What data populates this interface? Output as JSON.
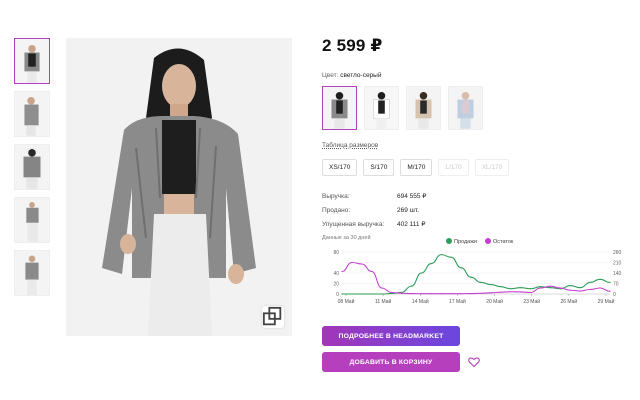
{
  "product": {
    "price": "2 599 ₽",
    "color_label": "Цвет:",
    "color_value": "светло-серый",
    "size_table_link": "Таблица размеров",
    "sizes": [
      {
        "label": "XS/170",
        "available": true
      },
      {
        "label": "S/170",
        "available": true
      },
      {
        "label": "M/170",
        "available": true
      },
      {
        "label": "L/170",
        "available": false
      },
      {
        "label": "XL/170",
        "available": false
      }
    ]
  },
  "stats": {
    "revenue_label": "Выручка:",
    "revenue_value": "694 555 ₽",
    "sold_label": "Продано:",
    "sold_value": "269 шт.",
    "lost_label": "Упущенная выручка:",
    "lost_value": "402 111 ₽",
    "note": "Данные за 30 дней"
  },
  "buttons": {
    "more": "ПОДРОБНЕЕ В HEADMARKET",
    "cart": "ДОБАВИТЬ В КОРЗИНУ"
  },
  "colors": {
    "accent": "#b63fc0",
    "sales": "#2e9e5b",
    "stock": "#c43fd0"
  },
  "chart_data": {
    "type": "line",
    "x": [
      "08 Май",
      "11 Май",
      "14 Май",
      "17 Май",
      "20 Май",
      "23 Май",
      "26 Май",
      "29 Май"
    ],
    "left_axis": {
      "ticks": [
        0,
        20,
        40,
        80
      ],
      "ylim": [
        0,
        80
      ]
    },
    "right_axis": {
      "ticks": [
        0,
        70,
        140,
        210,
        280
      ],
      "ylim": [
        0,
        280
      ]
    },
    "series": [
      {
        "name": "Продажи",
        "axis": "left",
        "values": [
          0,
          0,
          0,
          0,
          0,
          1,
          3,
          15,
          40,
          58,
          75,
          70,
          50,
          32,
          22,
          18,
          14,
          10,
          12,
          10,
          14,
          12,
          10,
          16,
          12,
          22,
          28,
          22
        ]
      },
      {
        "name": "Остаток",
        "axis": "right",
        "values": [
          150,
          210,
          200,
          150,
          40,
          10,
          5,
          3,
          2,
          2,
          2,
          2,
          2,
          3,
          5,
          8,
          12,
          15,
          14,
          10,
          40,
          52,
          40,
          25,
          20,
          30,
          40,
          18
        ]
      }
    ],
    "legend_position": "top-center",
    "grid": true
  }
}
